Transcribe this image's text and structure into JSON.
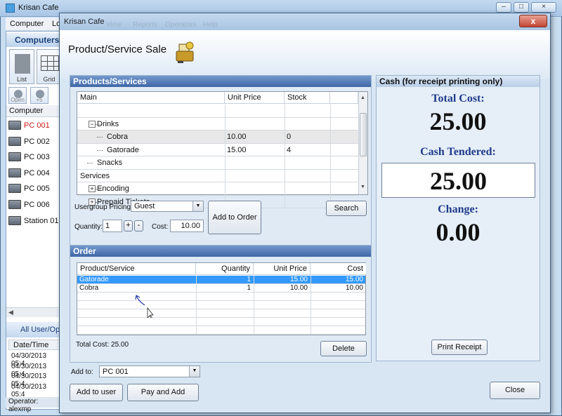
{
  "bg": {
    "title": "Krisan Cafe",
    "menu": [
      "Computer",
      "Lo"
    ],
    "computers_band": "Computers",
    "view_buttons": [
      "List",
      "Grid"
    ],
    "state_buttons": [
      "Open",
      "+5"
    ],
    "column_header": "Computer",
    "pcs": [
      "PC 001",
      "PC 002",
      "PC 003",
      "PC 004",
      "PC 005",
      "PC 006",
      "Station 01"
    ],
    "highlight_pc_color": "#d11a1a",
    "all_users_band": "All User/Op",
    "date_header": "Date/Time",
    "date_rows": [
      "04/30/2013 05:4",
      "04/30/2013 05:4",
      "04/30/2013 05:4",
      "04/30/2013 05:4"
    ],
    "operator": "Operator: alexmp"
  },
  "dialog": {
    "title": "Krisan Cafe",
    "ghost_menu": [
      "View",
      "Reports",
      "Operators",
      "Help"
    ],
    "close_glyph": "x",
    "heading": "Product/Service Sale",
    "products_title": "Products/Services",
    "products_columns": [
      "Main",
      "Unit Price",
      "Stock"
    ],
    "products_rows": [
      {
        "indent": 0,
        "expander": "",
        "name": "",
        "price": "",
        "stock": ""
      },
      {
        "indent": 1,
        "expander": "−",
        "name": "Drinks",
        "price": "",
        "stock": ""
      },
      {
        "indent": 2,
        "expander": "",
        "name": "Cobra",
        "price": "10.00",
        "stock": "0"
      },
      {
        "indent": 2,
        "expander": "",
        "name": "Gatorade",
        "price": "15.00",
        "stock": "4"
      },
      {
        "indent": 1,
        "expander": "",
        "name": "Snacks",
        "price": "",
        "stock": ""
      },
      {
        "indent": 0,
        "expander": "",
        "name": "Services",
        "price": "",
        "stock": ""
      },
      {
        "indent": 1,
        "expander": "+",
        "name": "Encoding",
        "price": "",
        "stock": ""
      },
      {
        "indent": 1,
        "expander": "+",
        "name": "Prepaid Tickets",
        "price": "",
        "stock": ""
      }
    ],
    "usergroup_label": "Usergroup Pricing:",
    "usergroup_value": "Guest",
    "quantity_label": "Quantity:",
    "quantity_value": "1",
    "plus": "+",
    "minus": "-",
    "cost_label": "Cost:",
    "cost_value": "10.00",
    "add_to_order": "Add to Order",
    "search": "Search",
    "order_title": "Order",
    "order_columns": [
      "Product/Service",
      "Quantity",
      "Unit Price",
      "Cost"
    ],
    "order_rows": [
      {
        "product": "Gatorade",
        "qty": "1",
        "price": "15.00",
        "cost": "15.00",
        "selected": true
      },
      {
        "product": "Cobra",
        "qty": "1",
        "price": "10.00",
        "cost": "10.00",
        "selected": false
      }
    ],
    "total_cost_text": "Total Cost:  25.00",
    "delete": "Delete",
    "add_to_label": "Add to:",
    "add_to_value": "PC 001",
    "add_to_user": "Add to user",
    "pay_and_add": "Pay and Add",
    "close": "Close",
    "cash_title": "Cash (for receipt printing only)",
    "total_cost_label": "Total Cost:",
    "total_cost_value": "25.00",
    "cash_tendered_label": "Cash Tendered:",
    "cash_tendered_value": "25.00",
    "change_label": "Change:",
    "change_value": "0.00",
    "print_receipt": "Print Receipt",
    "label_color": "#1f3a8a",
    "selection_color": "#3399ff"
  }
}
